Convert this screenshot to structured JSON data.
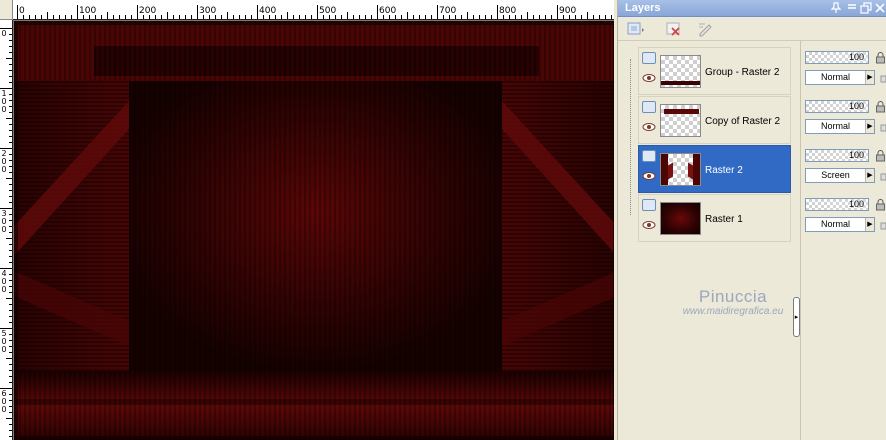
{
  "palette": {
    "title": "Layers",
    "title_icons": [
      "pin-icon",
      "close-icon",
      "restore-icon",
      "close-window-icon"
    ]
  },
  "layers": [
    {
      "name": "Group - Raster 2",
      "opacity": "100",
      "blend": "Normal",
      "selected": false
    },
    {
      "name": "Copy of Raster 2",
      "opacity": "100",
      "blend": "Normal",
      "selected": false
    },
    {
      "name": "Raster 2",
      "opacity": "100",
      "blend": "Screen",
      "selected": true
    },
    {
      "name": "Raster 1",
      "opacity": "100",
      "blend": "Normal",
      "selected": false
    }
  ],
  "watermark": {
    "title": "Pinuccia",
    "site": "www.maidiregrafica.eu"
  },
  "ruler": {
    "horizontal_labels": [
      "0",
      "100",
      "200",
      "300",
      "400",
      "500",
      "600",
      "700",
      "800",
      "900"
    ],
    "vertical_labels": [
      "0",
      "1 0 0",
      "2 0 0",
      "3 0 0",
      "4 0 0",
      "5 0 0",
      "6 0 0"
    ]
  },
  "colors": {
    "canvas_dark": "#1e0202",
    "canvas_red": "#6a0808",
    "selection": "#316ac5",
    "title_bar": "#8aa6d8"
  }
}
